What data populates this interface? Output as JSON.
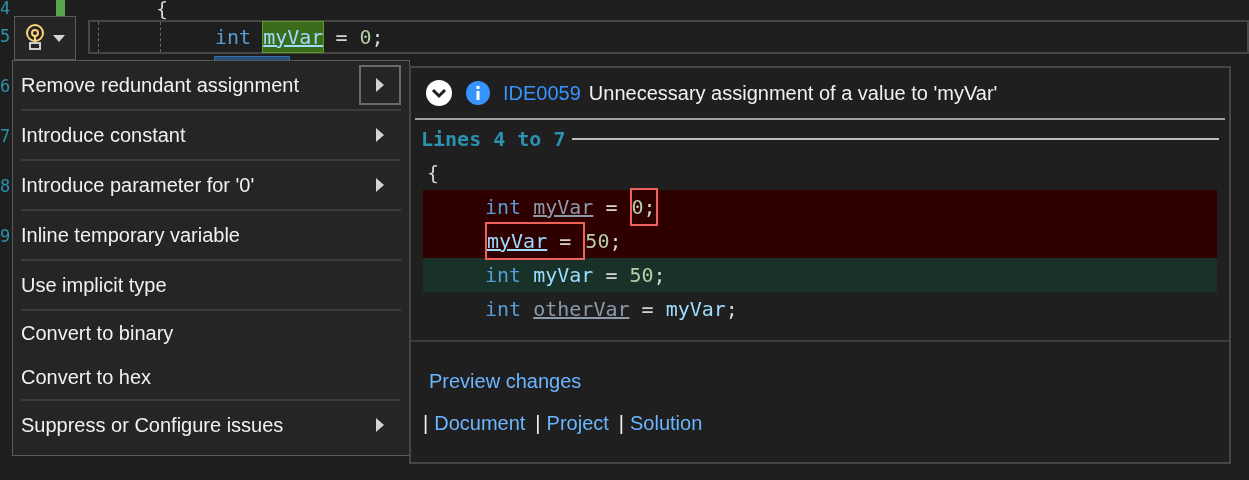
{
  "editor": {
    "line_numbers": [
      "4",
      "5",
      "6",
      "7",
      "8",
      "9"
    ],
    "lines": [
      {
        "current": false,
        "tokens": [
          {
            "text": "{",
            "kind": "punct"
          }
        ]
      },
      {
        "current": true,
        "tokens": [
          {
            "text": "int ",
            "kind": "keyword"
          },
          {
            "text": "myVar",
            "kind": "ident",
            "highlight": true
          },
          {
            "text": " = ",
            "kind": "punct"
          },
          {
            "text": "0",
            "kind": "number"
          },
          {
            "text": ";",
            "kind": "punct"
          }
        ]
      }
    ]
  },
  "light_bulb": {
    "expanded": true
  },
  "menu": {
    "groups": [
      [
        {
          "label": "Remove redundant assignment",
          "submenu": true,
          "submenu_open": true
        }
      ],
      [
        {
          "label": "Introduce constant",
          "submenu": true,
          "submenu_open": false
        }
      ],
      [
        {
          "label": "Introduce parameter for '0'",
          "submenu": true,
          "submenu_open": false
        }
      ],
      [
        {
          "label": "Inline temporary variable",
          "submenu": false
        }
      ],
      [
        {
          "label": "Use implicit type",
          "submenu": false
        }
      ],
      [
        {
          "label": "Convert to binary",
          "submenu": false
        },
        {
          "label": "Convert to hex",
          "submenu": false
        }
      ],
      [
        {
          "label": "Suppress or Configure issues",
          "submenu": true,
          "submenu_open": false
        }
      ]
    ]
  },
  "preview": {
    "diagnostic_id": "IDE0059",
    "message": "Unnecessary assignment of a value to 'myVar'",
    "range_label": "Lines 4 to 7",
    "lines": [
      {
        "kind": "context",
        "tokens": [
          {
            "text": "{",
            "kind": "punct"
          }
        ],
        "children": [
          {
            "kind": "removed",
            "tokens": [
              {
                "text": "int ",
                "kind": "keyword"
              },
              {
                "text": "myVar",
                "kind": "faded"
              },
              {
                "text": " = ",
                "kind": "punct"
              },
              {
                "boxed": true,
                "parts": [
                  {
                    "text": "0",
                    "kind": "number"
                  },
                  {
                    "text": ";",
                    "kind": "punct"
                  }
                ]
              }
            ]
          },
          {
            "kind": "removed",
            "tokens": [
              {
                "boxed": true,
                "parts": [
                  {
                    "text": "myVar",
                    "kind": "ident_underlined"
                  },
                  {
                    "text": " = ",
                    "kind": "punct"
                  }
                ]
              },
              {
                "text": "50",
                "kind": "number"
              },
              {
                "text": ";",
                "kind": "punct"
              }
            ]
          },
          {
            "kind": "added",
            "tokens": [
              {
                "text": "int ",
                "kind": "keyword"
              },
              {
                "text": "myVar",
                "kind": "ident"
              },
              {
                "text": " = ",
                "kind": "punct"
              },
              {
                "text": "50",
                "kind": "number"
              },
              {
                "text": ";",
                "kind": "punct"
              }
            ]
          },
          {
            "kind": "context",
            "tokens": [
              {
                "text": "int ",
                "kind": "keyword"
              },
              {
                "text": "otherVar",
                "kind": "faded"
              },
              {
                "text": " = ",
                "kind": "punct"
              },
              {
                "text": "myVar",
                "kind": "ident"
              },
              {
                "text": ";",
                "kind": "punct"
              }
            ]
          }
        ]
      }
    ],
    "preview_link": "Preview changes",
    "scopes": [
      {
        "prefix": "|",
        "label": "Document"
      },
      {
        "prefix": "|",
        "label": "Project"
      },
      {
        "prefix": "|",
        "label": "Solution"
      }
    ]
  }
}
